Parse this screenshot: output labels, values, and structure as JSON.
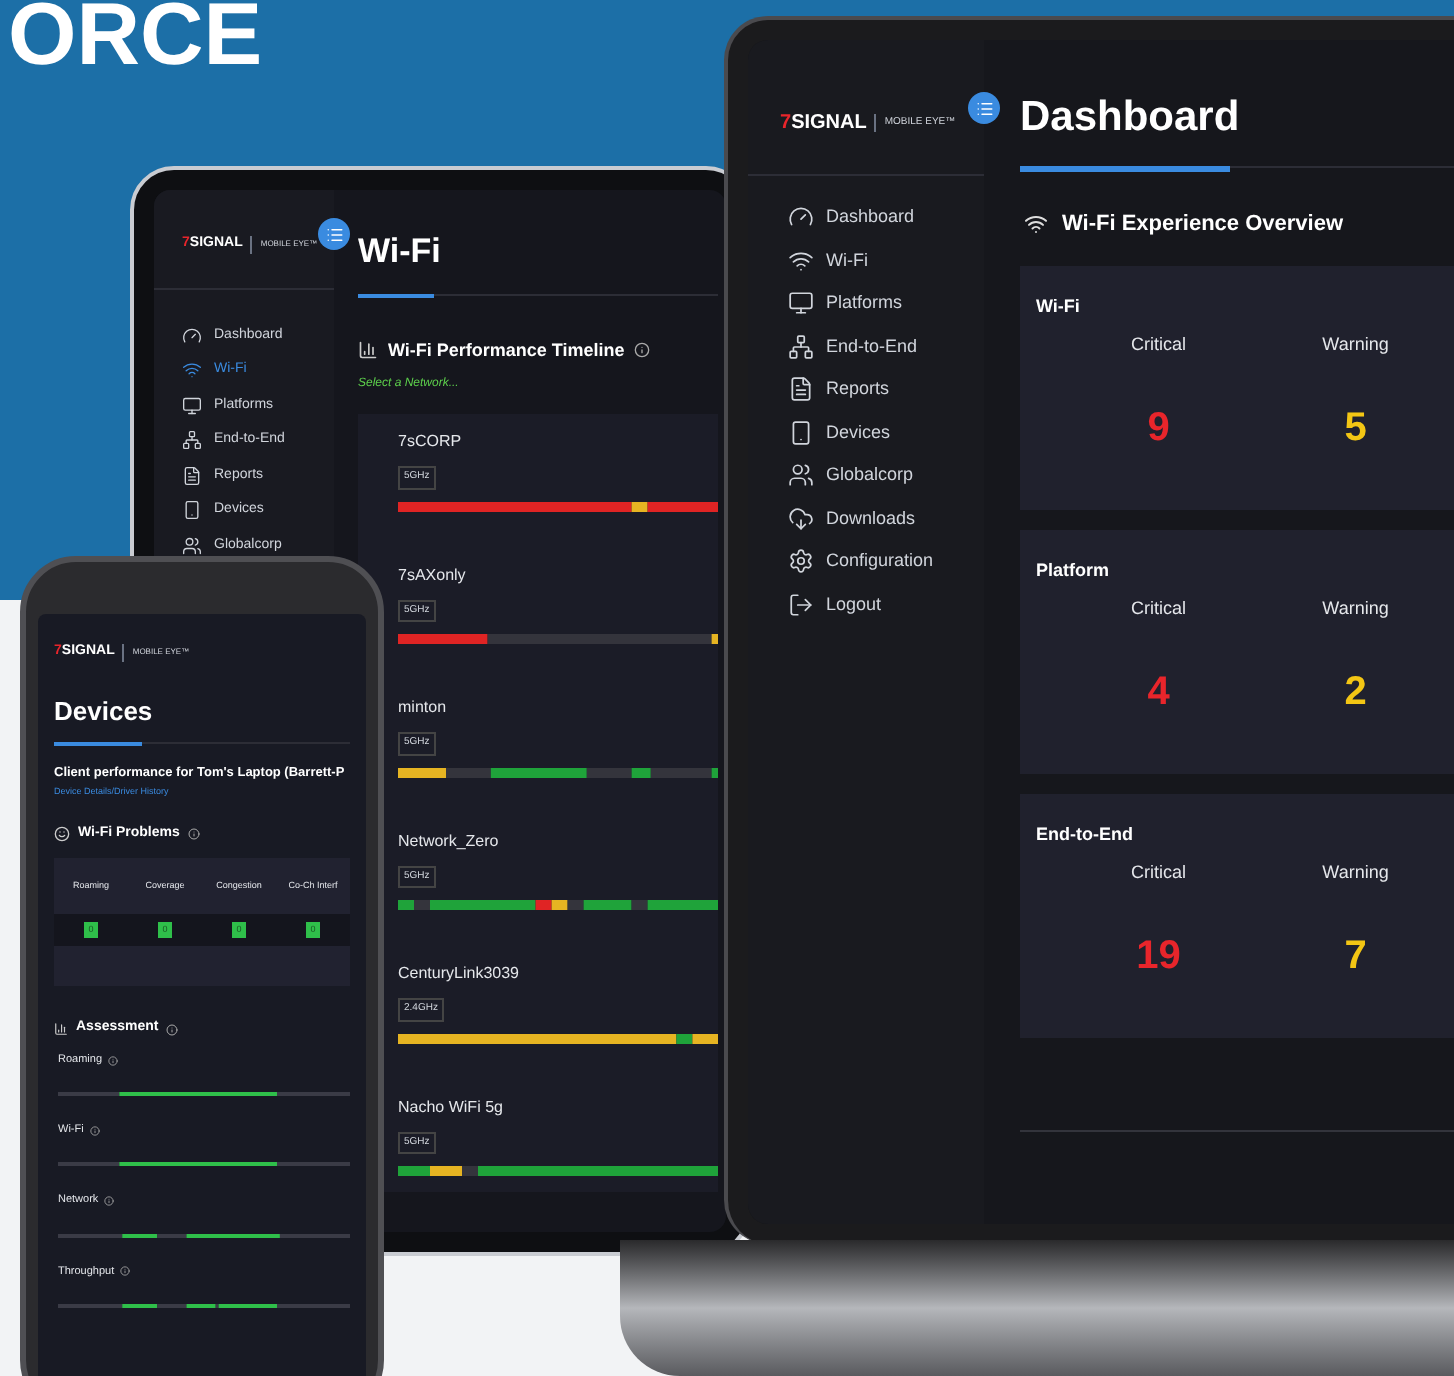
{
  "headline": "ORCE",
  "tablet": {
    "logo": "7SIGNAL",
    "product": "MOBILE EYE™",
    "nav": [
      {
        "label": "Dashboard",
        "selected": false
      },
      {
        "label": "Wi-Fi",
        "selected": true
      },
      {
        "label": "Platforms",
        "selected": false
      },
      {
        "label": "End-to-End",
        "selected": false
      },
      {
        "label": "Reports",
        "selected": false
      },
      {
        "label": "Devices",
        "selected": false
      },
      {
        "label": "Globalcorp",
        "selected": false
      }
    ],
    "title": "Wi-Fi",
    "section": "Wi-Fi Performance Timeline",
    "hint": "Select a Network...",
    "networks": [
      {
        "name": "7sCORP",
        "band": "5GHz"
      },
      {
        "name": "7sAXonly",
        "band": "5GHz"
      },
      {
        "name": "minton",
        "band": "5GHz"
      },
      {
        "name": "Network_Zero",
        "band": "5GHz"
      },
      {
        "name": "CenturyLink3039",
        "band": "2.4GHz"
      },
      {
        "name": "Nacho WiFi 5g",
        "band": "5GHz"
      }
    ]
  },
  "laptop": {
    "logo": "7SIGNAL",
    "product": "MOBILE EYE™",
    "nav": [
      {
        "label": "Dashboard",
        "selected": false
      },
      {
        "label": "Wi-Fi",
        "selected": false
      },
      {
        "label": "Platforms",
        "selected": false
      },
      {
        "label": "End-to-End",
        "selected": false
      },
      {
        "label": "Reports",
        "selected": false
      },
      {
        "label": "Devices",
        "selected": false
      },
      {
        "label": "Globalcorp",
        "selected": false
      },
      {
        "label": "Downloads",
        "selected": false
      },
      {
        "label": "Configuration",
        "selected": false
      },
      {
        "label": "Logout",
        "selected": false
      }
    ],
    "title": "Dashboard",
    "section": "Wi-Fi Experience Overview",
    "cards": [
      {
        "title": "Wi-Fi",
        "stats": [
          {
            "label": "Critical",
            "value": "9",
            "color": "#e8252b"
          },
          {
            "label": "Warning",
            "value": "5",
            "color": "#f3c614"
          }
        ]
      },
      {
        "title": "Platform",
        "stats": [
          {
            "label": "Critical",
            "value": "4",
            "color": "#e8252b"
          },
          {
            "label": "Warning",
            "value": "2",
            "color": "#f3c614"
          }
        ]
      },
      {
        "title": "End-to-End",
        "stats": [
          {
            "label": "Critical",
            "value": "19",
            "color": "#e8252b"
          },
          {
            "label": "Warning",
            "value": "7",
            "color": "#f3c614"
          }
        ]
      }
    ]
  },
  "phone": {
    "logo": "7SIGNAL",
    "product": "MOBILE EYE™",
    "title": "Devices",
    "subtitle": "Client performance for Tom's Laptop (Barrett-P",
    "link": "Device Details/Driver History",
    "problems": {
      "title": "Wi-Fi Problems",
      "columns": [
        "Roaming",
        "Coverage",
        "Congestion",
        "Co-Ch Interf"
      ],
      "values": [
        "0",
        "0",
        "0",
        "0"
      ]
    },
    "assessment": {
      "title": "Assessment",
      "rows": [
        {
          "label": "Roaming"
        },
        {
          "label": "Wi-Fi"
        },
        {
          "label": "Network"
        },
        {
          "label": "Throughput"
        }
      ]
    }
  }
}
